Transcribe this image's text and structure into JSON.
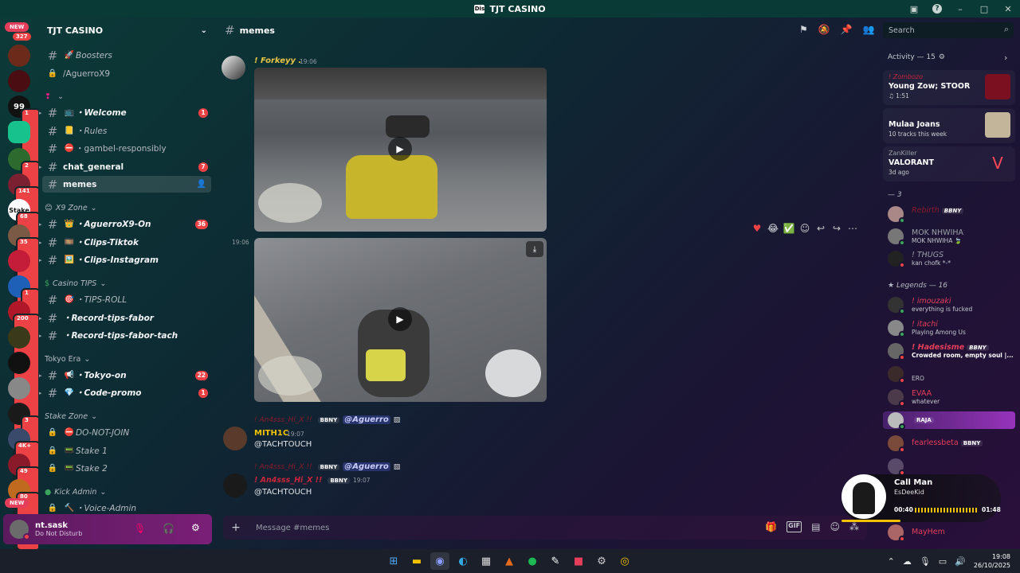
{
  "window": {
    "title": "TJT CASINO",
    "logo": "Dis"
  },
  "servers": {
    "new_top": "NEW",
    "count_top": "327",
    "new_bottom": "NEW",
    "badges": [
      "1",
      "2",
      "141",
      "68",
      "35",
      "1",
      "200",
      "3",
      "4K+",
      "49",
      "80"
    ]
  },
  "guild": {
    "name": "TJT CASINO"
  },
  "channels": [
    {
      "type": "text",
      "emoji": "🚀",
      "name": "Boosters",
      "style": "it",
      "badge": ""
    },
    {
      "type": "lock",
      "emoji": "",
      "name": "/AguerroX9",
      "style": "",
      "badge": ""
    },
    {
      "type": "text",
      "emoji": "📺",
      "name": "・Welcome",
      "style": "b",
      "badge": "1"
    },
    {
      "type": "text",
      "emoji": "📒",
      "name": "・Rules",
      "style": "it",
      "badge": ""
    },
    {
      "type": "text",
      "emoji": "⛔",
      "name": "・gambel-responsibly",
      "style": "",
      "badge": ""
    },
    {
      "type": "text",
      "emoji": "",
      "name": "chat_general",
      "style": "b",
      "badge": "7"
    },
    {
      "type": "text",
      "emoji": "",
      "name": "memes",
      "style": "b",
      "badge": "",
      "active": true
    },
    {
      "type": "text",
      "emoji": "👑",
      "name": "・AguerroX9-On",
      "style": "b",
      "badge": "36"
    },
    {
      "type": "text",
      "emoji": "🎞️",
      "name": "・Clips-Tiktok",
      "style": "b",
      "badge": ""
    },
    {
      "type": "text",
      "emoji": "🖼️",
      "name": "・Clips-Instagram",
      "style": "b",
      "badge": ""
    },
    {
      "type": "text",
      "emoji": "🎯",
      "name": "・TIPS-ROLL",
      "style": "it",
      "badge": ""
    },
    {
      "type": "text",
      "emoji": "",
      "name": "・Record-tips-fabor",
      "style": "b",
      "badge": ""
    },
    {
      "type": "text",
      "emoji": "",
      "name": "・Record-tips-fabor-tach",
      "style": "b",
      "badge": ""
    },
    {
      "type": "text",
      "emoji": "📢",
      "name": "・Tokyo-on",
      "style": "b",
      "badge": "22"
    },
    {
      "type": "text",
      "emoji": "💎",
      "name": "・Code-promo",
      "style": "b",
      "badge": "1"
    },
    {
      "type": "lock",
      "emoji": "⛔",
      "name": "DO-NOT-JOIN",
      "style": "it",
      "badge": ""
    },
    {
      "type": "lock",
      "emoji": "📟",
      "name": "Stake 1",
      "style": "it",
      "badge": ""
    },
    {
      "type": "lock",
      "emoji": "📟",
      "name": "Stake 2",
      "style": "it",
      "badge": ""
    },
    {
      "type": "lock",
      "emoji": "🔨",
      "name": "・Voice-Admin",
      "style": "it",
      "badge": ""
    }
  ],
  "categories": {
    "c0": "",
    "c1": "X9 Zone",
    "c2": "Casino TIPS",
    "c3": "Tokyo Era",
    "c4": "Stake Zone",
    "c5": "Kick Admin"
  },
  "user": {
    "name": "nt.sask",
    "status": "Do Not Disturb"
  },
  "channel_header": {
    "name": "memes",
    "search_placeholder": "Search"
  },
  "messages": {
    "m1": {
      "author": "! Forkeyy .",
      "time": "19:06"
    },
    "m2": {
      "time": "19:06"
    },
    "m3": {
      "reply_author": "! An4sss_Hi_X !!",
      "reply_tag": "BBNY",
      "reply_mention": "@Aguerro",
      "author": "MITH1C",
      "time": "19:07",
      "text": "@TACHTOUCH"
    },
    "m4": {
      "reply_author": "! An4sss_Hi_X !!",
      "reply_tag": "BBNY",
      "reply_mention": "@Aguerro",
      "author": "! An4sss_Hi_X !!",
      "author_tag": "BBNY",
      "time": "19:07",
      "text": "@TACHTOUCH"
    }
  },
  "composer": {
    "placeholder": "Message #memes"
  },
  "activity": {
    "header": "Activity — 15",
    "items": [
      {
        "user": "! Zombozo",
        "title": "Young Zow; STOOR",
        "sub": "♫ 1:51"
      },
      {
        "user": "",
        "title": "Mulaa Joans",
        "sub": "10 tracks this week"
      },
      {
        "user": "ZanKiller",
        "title": "VALORANT",
        "sub": "3d ago"
      }
    ]
  },
  "member_sections": {
    "s1": "— 3",
    "s2": "Legends — 16"
  },
  "members": [
    {
      "name": "Rebirth",
      "tag": "BBNY",
      "status": ""
    },
    {
      "name": "MOK NHWIHA",
      "tag": "",
      "status": "MOK NHWIHA 🍃"
    },
    {
      "name": "! THUGS",
      "tag": "",
      "status": "kan chofk *-*"
    },
    {
      "name": "! imouzaki",
      "tag": "",
      "status": "everything is fucked"
    },
    {
      "name": "! itachi",
      "tag": "",
      "status": "Playing Among Us"
    },
    {
      "name": "! Hadesisme",
      "tag": "BBNY",
      "status": "Crowded room, empty soul |..."
    },
    {
      "name": "",
      "tag": "",
      "status": "ERO"
    },
    {
      "name": "EVAA",
      "tag": "",
      "status": "whatever"
    },
    {
      "name": "",
      "tag": "RAJA",
      "status": ""
    },
    {
      "name": "fearlessbeta",
      "tag": "BBNY",
      "status": ""
    },
    {
      "name": "",
      "tag": "",
      "status": ""
    },
    {
      "name": "MayHem",
      "tag": "",
      "status": ""
    }
  ],
  "player": {
    "title": "Call Man",
    "artist": "EsDeeKid",
    "elapsed": "00:40",
    "total": "01:48",
    "progress": 0.37
  },
  "clock": {
    "time": "19:08",
    "date": "26/10/2025"
  },
  "colors": {
    "accent": "#5865f2",
    "danger": "#ed4245",
    "gold": "#f2c200"
  }
}
